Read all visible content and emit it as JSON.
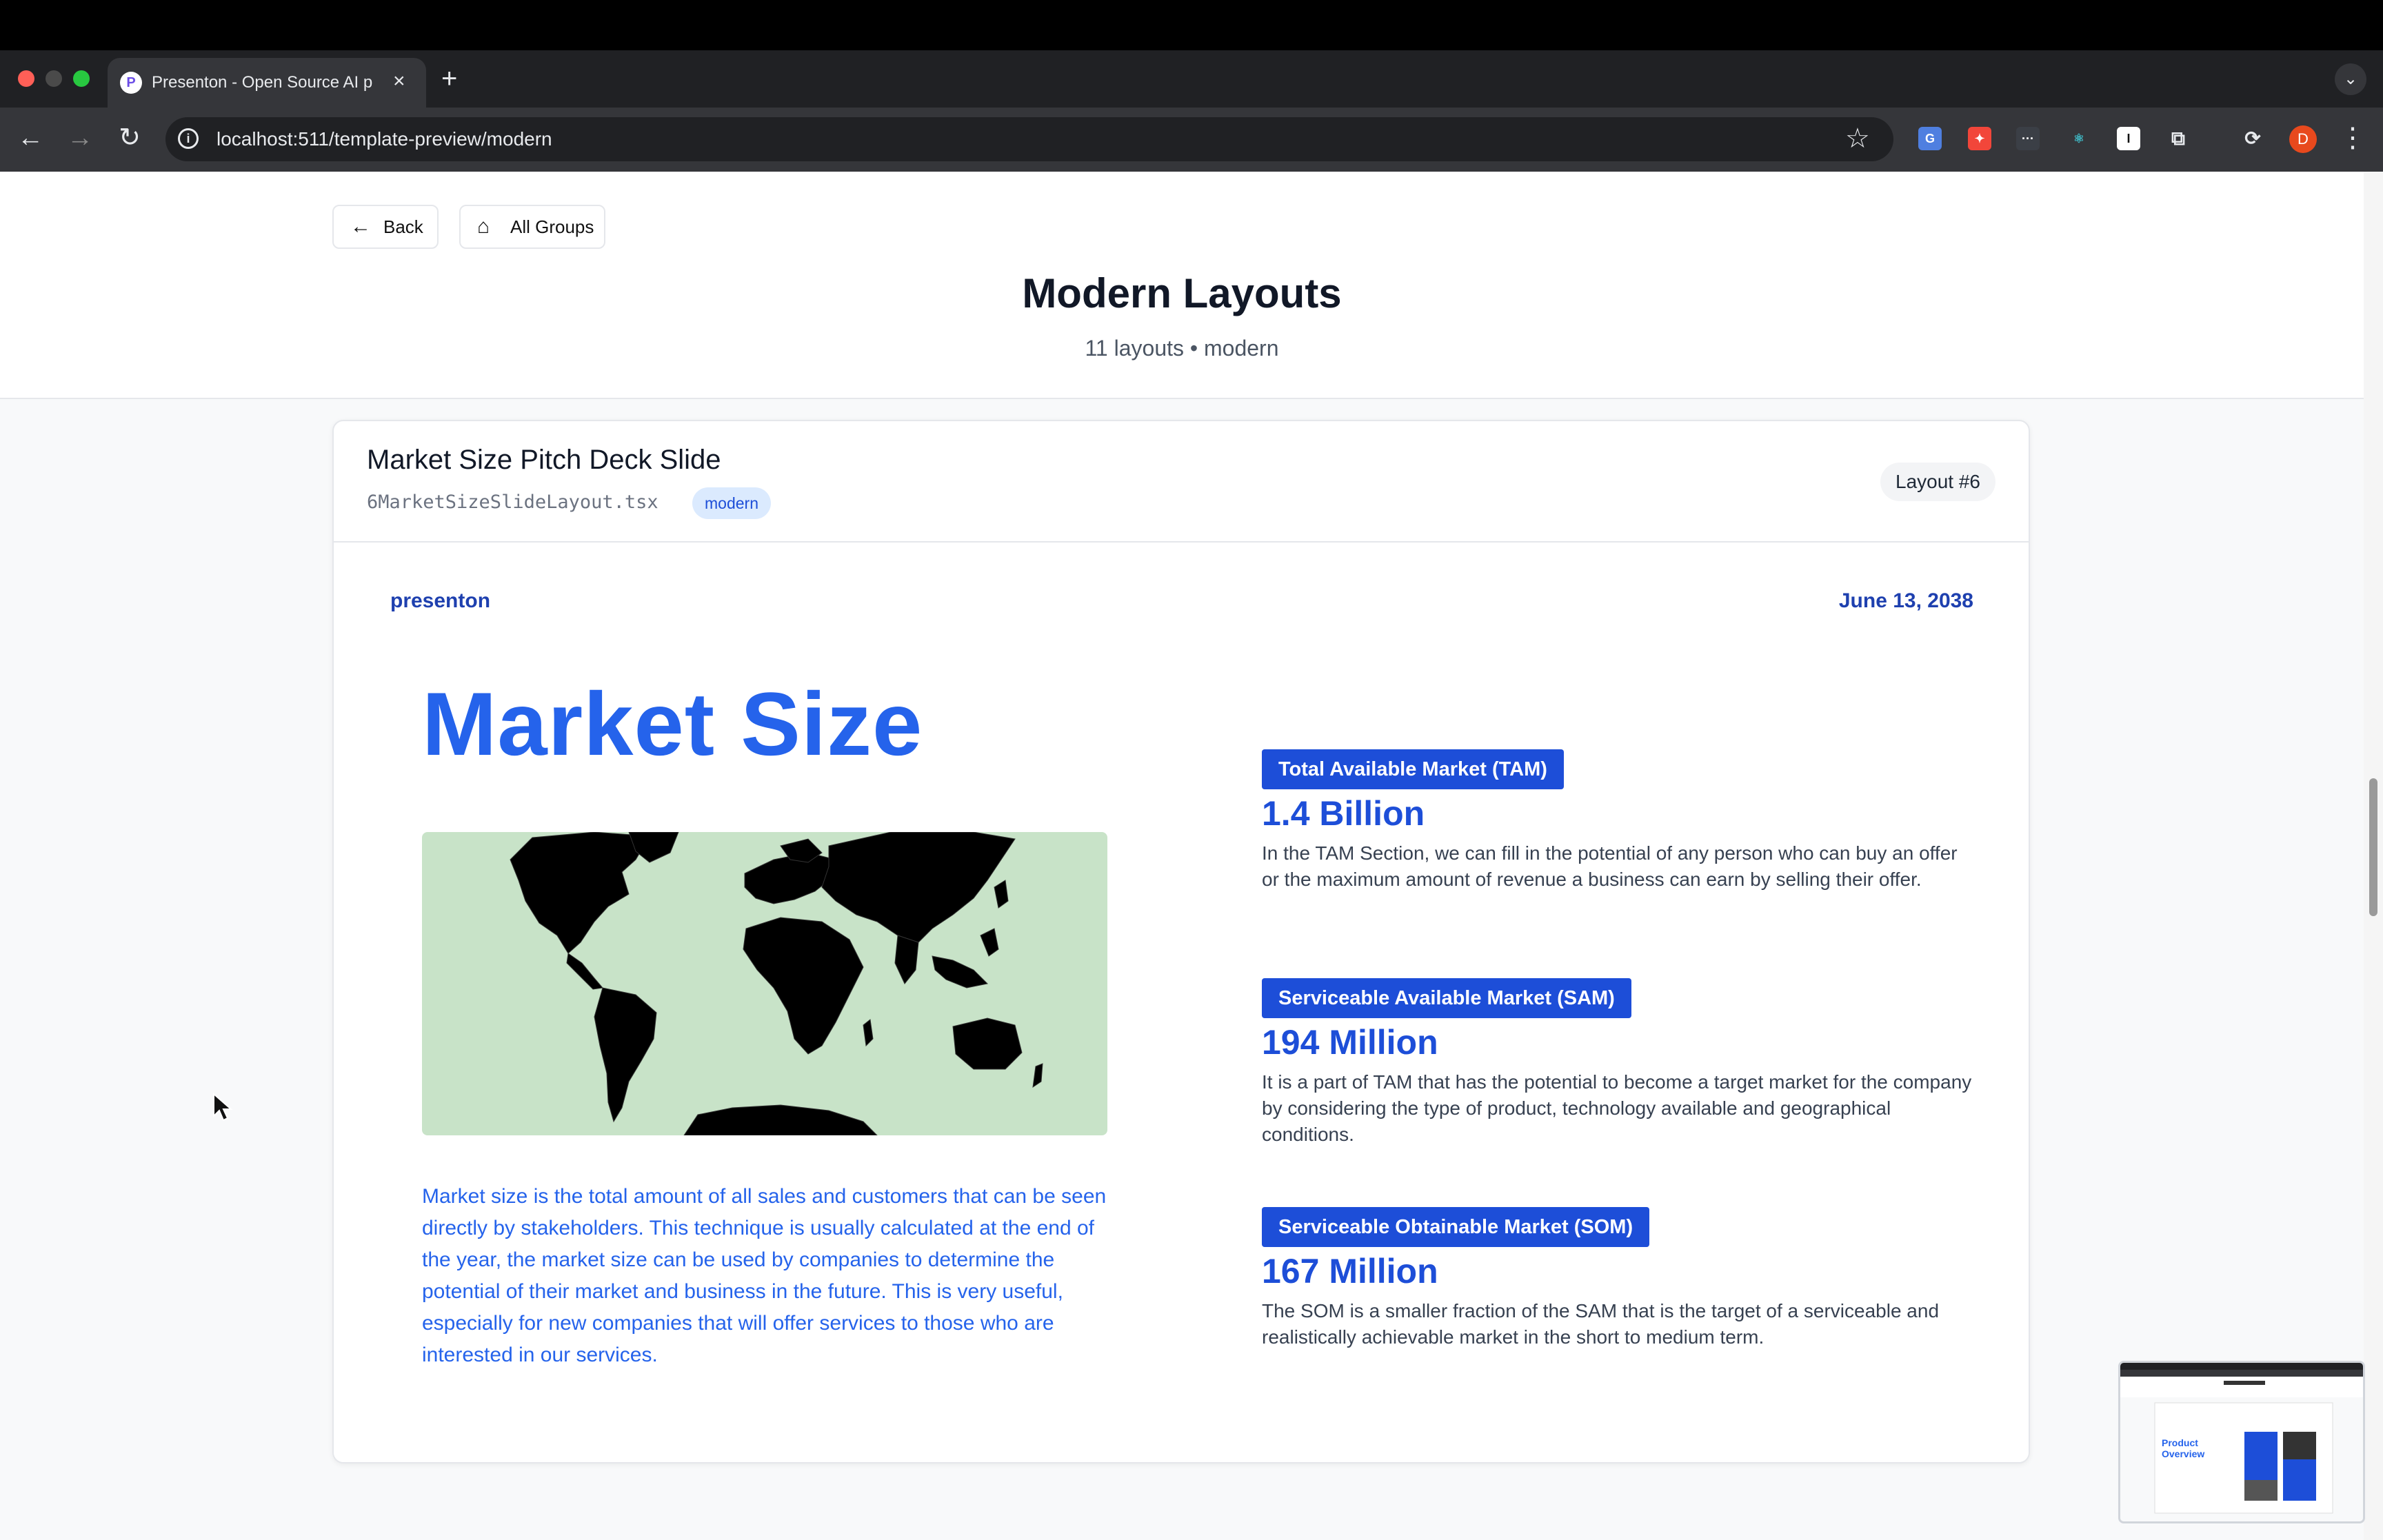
{
  "browser": {
    "tab_title": "Presenton - Open Source AI p",
    "tab_favicon": "P",
    "url": "localhost:511/template-preview/modern",
    "avatar_letter": "D"
  },
  "header": {
    "back_label": "Back",
    "all_groups_label": "All Groups",
    "title": "Modern Layouts",
    "subtitle": "11 layouts • modern"
  },
  "card": {
    "title": "Market Size Pitch Deck Slide",
    "file": "6MarketSizeSlideLayout.tsx",
    "tag": "modern",
    "layout_badge": "Layout #6"
  },
  "slide": {
    "brand": "presenton",
    "date": "June 13, 2038",
    "title": "Market Size",
    "description": "Market size is the total amount of all sales and customers that can be seen directly by stakeholders. This technique is usually calculated at the end of the year, the market size can be used by companies to determine the potential of their market and business in the future. This is very useful, especially for new companies that will offer services to those who are interested in our services.",
    "markets": [
      {
        "label": "Total Available Market (TAM)",
        "value": "1.4 Billion",
        "desc": "In the TAM Section, we can fill in the potential of any person who can buy an offer or the maximum amount of revenue a business can earn by selling their offer."
      },
      {
        "label": "Serviceable Available Market (SAM)",
        "value": "194 Million",
        "desc": "It is a part of TAM that has the potential to become a target market for the company by considering the type of product, technology available and geographical conditions."
      },
      {
        "label": "Serviceable Obtainable Market (SOM)",
        "value": "167 Million",
        "desc": "The SOM is a smaller fraction of the SAM that is the target of a serviceable and realistically achievable market in the short to medium term."
      }
    ]
  },
  "thumbnail": {
    "title": "Product Overview"
  },
  "colors": {
    "accent": "#2563eb",
    "label_bg": "#1d4ed8",
    "map_bg": "#c8e3c8"
  }
}
